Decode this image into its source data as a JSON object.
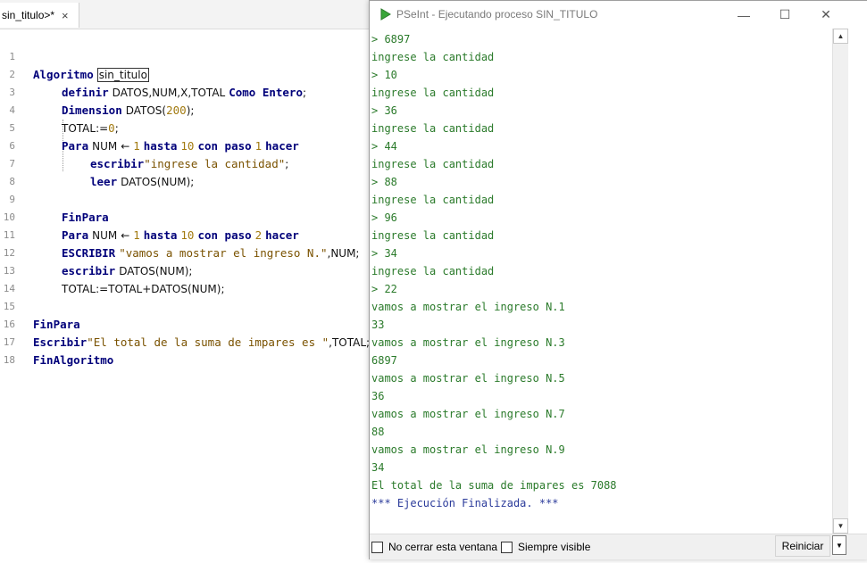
{
  "editor": {
    "tab": {
      "label": "sin_titulo>*",
      "close_icon": "×"
    },
    "line_numbers": [
      "1",
      "2",
      "3",
      "4",
      "5",
      "6",
      "7",
      "8",
      "9",
      "10",
      "11",
      "12",
      "13",
      "14",
      "15",
      "16",
      "17",
      "18"
    ],
    "code": {
      "l1_kw": "Algoritmo",
      "l1_name": "sin_titulo",
      "l2_kw": "definir",
      "l2_ids": "DATOS,NUM,X,TOTAL",
      "l2_kw2": "Como Entero",
      "l2_end": ";",
      "l3_kw": "Dimension",
      "l3_a": "DATOS(",
      "l3_num": "200",
      "l3_b": ");",
      "l4_a": "TOTAL:=",
      "l4_num": "0",
      "l4_b": ";",
      "l5_kw": "Para",
      "l5_a": "NUM",
      "l5_arrow": "←",
      "l5_n1": "1",
      "l5_kw2": "hasta",
      "l5_n2": "10",
      "l5_kw3": "con paso",
      "l5_n3": "1",
      "l5_kw4": "hacer",
      "l6_kw": "escribir",
      "l6_str": "\"ingrese la cantidad\"",
      "l6_end": ";",
      "l7_kw": "leer",
      "l7_a": "DATOS(NUM);",
      "l9_kw": "FinPara",
      "l10_kw": "Para",
      "l10_a": "NUM",
      "l10_arrow": "←",
      "l10_n1": "1",
      "l10_kw2": "hasta",
      "l10_n2": "10",
      "l10_kw3": "con paso",
      "l10_n3": "2",
      "l10_kw4": "hacer",
      "l11_kw": "ESCRIBIR",
      "l11_str": "\"vamos a mostrar el ingreso N.\"",
      "l11_a": ",NUM;",
      "l12_kw": "escribir",
      "l12_a": "DATOS(NUM);",
      "l13_a": "TOTAL:=TOTAL+DATOS(NUM);",
      "l15_kw": "FinPara",
      "l16_kw": "Escribir",
      "l16_str": "\"El total de la suma de impares es \"",
      "l16_a": ",TOTAL;",
      "l17_kw": "FinAlgoritmo"
    }
  },
  "console_window": {
    "title": "PSeInt - Ejecutando proceso SIN_TITULO",
    "buttons": {
      "minimize": "—",
      "maximize": "☐",
      "close": "✕"
    },
    "lines": [
      "> 6897",
      "ingrese la cantidad",
      "> 10",
      "ingrese la cantidad",
      "> 36",
      "ingrese la cantidad",
      "> 44",
      "ingrese la cantidad",
      "> 88",
      "ingrese la cantidad",
      "> 96",
      "ingrese la cantidad",
      "> 34",
      "ingrese la cantidad",
      "> 22",
      "vamos a mostrar el ingreso N.1",
      "33",
      "vamos a mostrar el ingreso N.3",
      "6897",
      "vamos a mostrar el ingreso N.5",
      "36",
      "vamos a mostrar el ingreso N.7",
      "88",
      "vamos a mostrar el ingreso N.9",
      "34",
      "El total de la suma de impares es 7088",
      "*** Ejecución Finalizada. ***"
    ],
    "status": {
      "keep_open_label": "No cerrar esta ventana",
      "always_visible_label": "Siempre visible",
      "reset_label": "Reiniciar"
    }
  },
  "colors": {
    "keyword": "#00007a",
    "string": "#7a5200",
    "number": "#a27a10",
    "console_text": "#2a7a2a",
    "console_final": "#2a3a9a",
    "app_icon": "#3aa63a"
  }
}
